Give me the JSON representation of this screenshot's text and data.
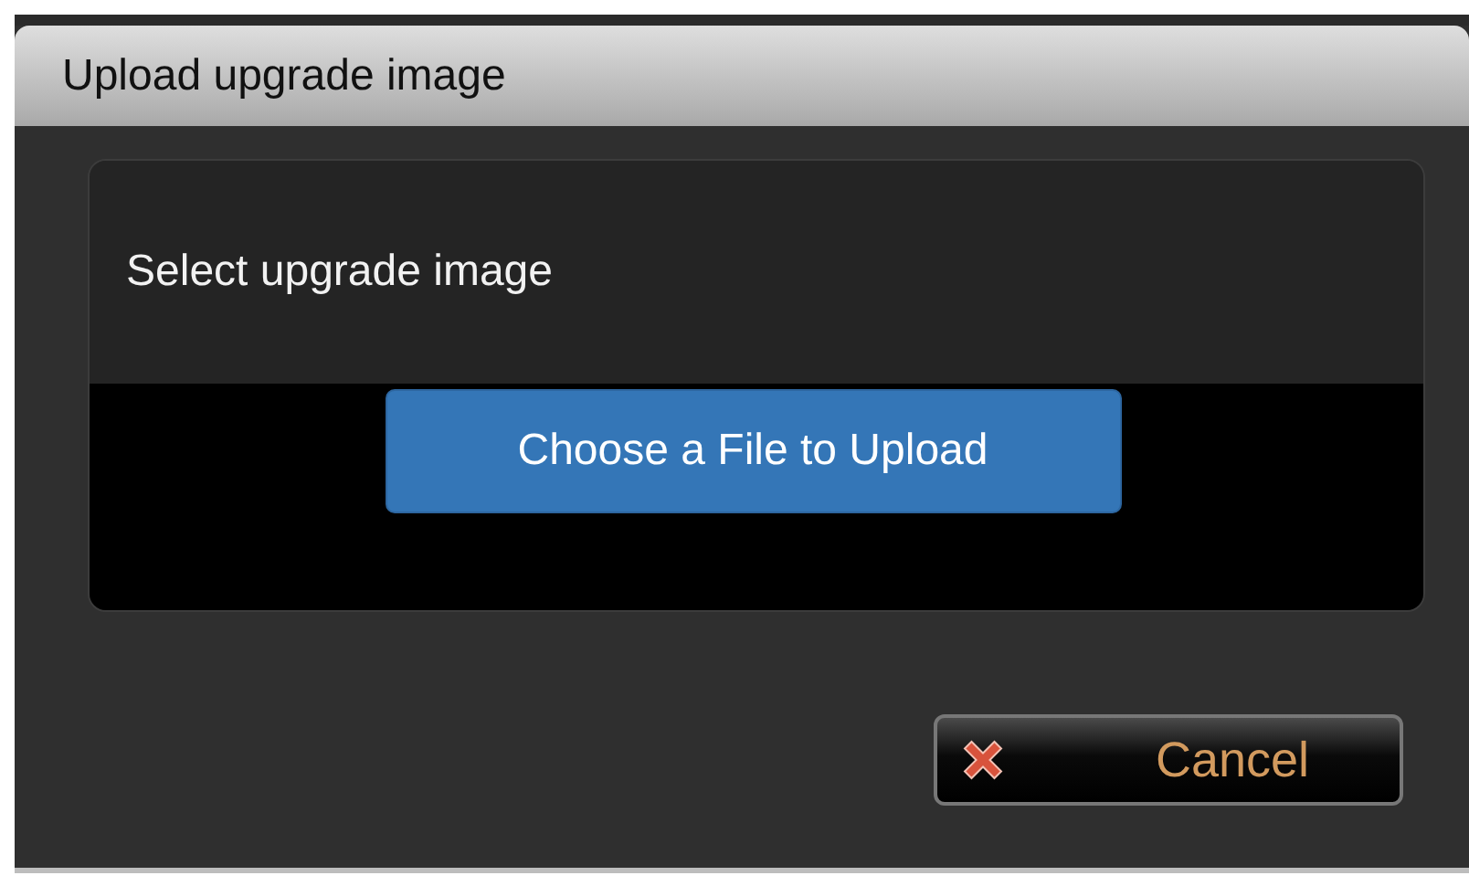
{
  "dialog": {
    "title": "Upload upgrade image"
  },
  "panel": {
    "label": "Select upgrade image",
    "upload_button": "Choose a File to Upload"
  },
  "buttons": [
    {
      "kind": "cancel",
      "label": "Cancel"
    }
  ]
}
